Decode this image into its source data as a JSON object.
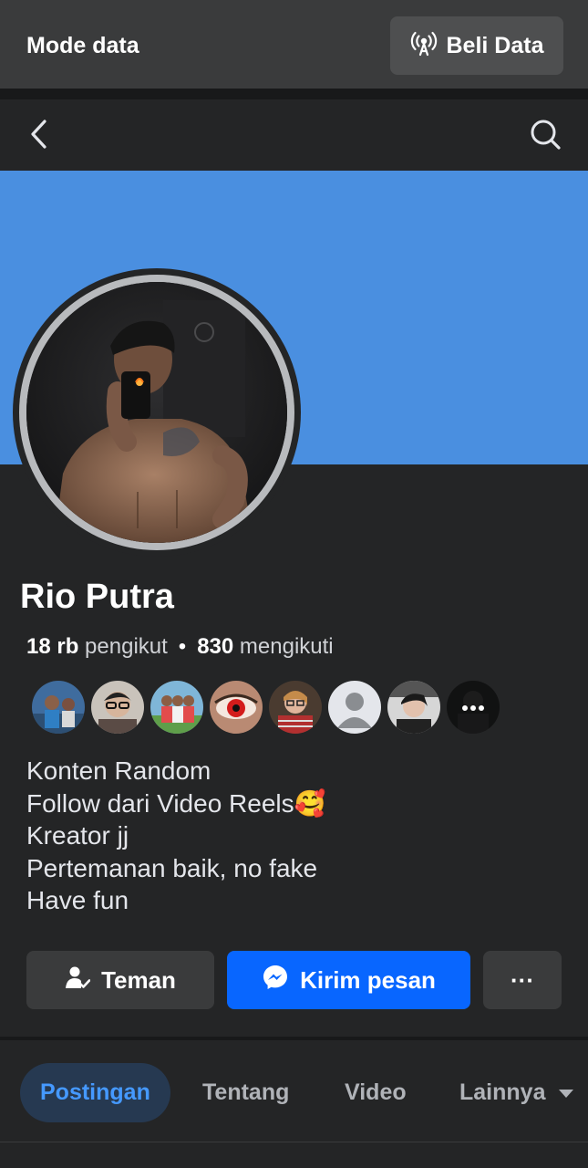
{
  "data_bar": {
    "title": "Mode data",
    "buy_label": "Beli Data"
  },
  "nav": {
    "back_icon": "chevron-left-icon",
    "search_icon": "search-icon"
  },
  "colors": {
    "cover": "#4a8fe0",
    "accent": "#0866ff",
    "tab_active_text": "#4599ff",
    "background": "#242526"
  },
  "profile": {
    "name": "Rio Putra",
    "followers_count": "18 rb",
    "followers_label": "pengikut",
    "separator": "•",
    "following_count": "830",
    "following_label": "mengikuti"
  },
  "friends_preview": {
    "count": 8,
    "more_icon": "ellipsis-icon"
  },
  "bio": {
    "lines": [
      "Konten Random",
      "Follow dari Video Reels",
      "Kreator jj",
      "Pertemanan baik, no fake",
      "Have fun"
    ],
    "emoji": "🥰"
  },
  "actions": {
    "friends_label": "Teman",
    "message_label": "Kirim pesan",
    "more_label": "···"
  },
  "tabs": [
    {
      "label": "Postingan",
      "active": true
    },
    {
      "label": "Tentang",
      "active": false
    },
    {
      "label": "Video",
      "active": false
    },
    {
      "label": "Lainnya",
      "active": false
    }
  ]
}
